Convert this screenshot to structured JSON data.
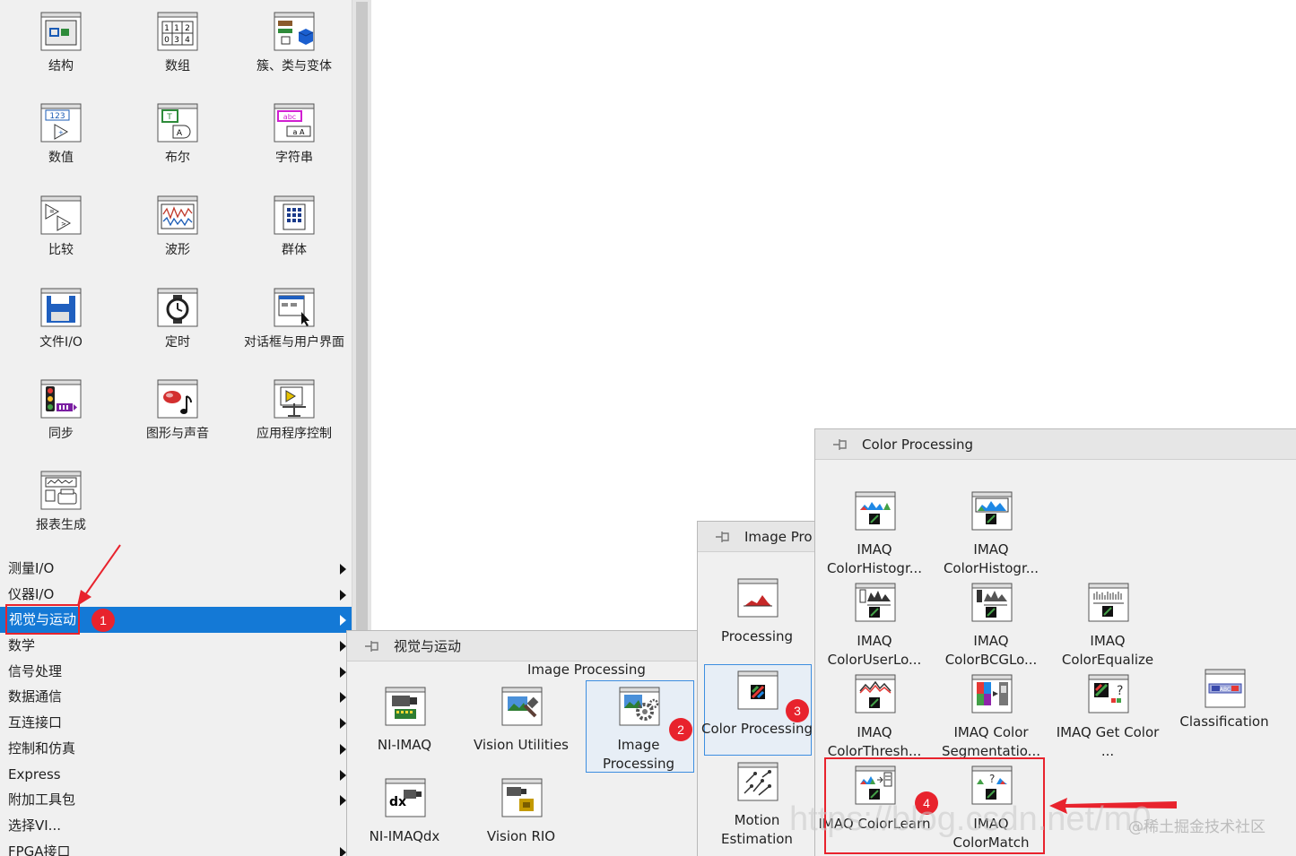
{
  "palette": {
    "items": [
      {
        "label": "结构",
        "icon": "structures-icon"
      },
      {
        "label": "数组",
        "icon": "array-icon"
      },
      {
        "label": "簇、类与变体",
        "icon": "cluster-class-variant-icon"
      },
      {
        "label": "数值",
        "icon": "numeric-icon"
      },
      {
        "label": "布尔",
        "icon": "boolean-icon"
      },
      {
        "label": "字符串",
        "icon": "string-icon"
      },
      {
        "label": "比较",
        "icon": "comparison-icon"
      },
      {
        "label": "波形",
        "icon": "waveform-icon"
      },
      {
        "label": "群体",
        "icon": "ensemble-icon"
      },
      {
        "label": "文件I/O",
        "icon": "file-io-icon"
      },
      {
        "label": "定时",
        "icon": "timing-icon"
      },
      {
        "label": "对话框与用户界面",
        "icon": "dialog-ui-icon"
      },
      {
        "label": "同步",
        "icon": "synchronization-icon"
      },
      {
        "label": "图形与声音",
        "icon": "graphics-sound-icon"
      },
      {
        "label": "应用程序控制",
        "icon": "app-control-icon"
      },
      {
        "label": "报表生成",
        "icon": "report-generation-icon"
      }
    ],
    "menu": [
      {
        "label": "测量I/O",
        "selected": false
      },
      {
        "label": "仪器I/O",
        "selected": false
      },
      {
        "label": "视觉与运动",
        "selected": true
      },
      {
        "label": "数学",
        "selected": false
      },
      {
        "label": "信号处理",
        "selected": false
      },
      {
        "label": "数据通信",
        "selected": false
      },
      {
        "label": "互连接口",
        "selected": false
      },
      {
        "label": "控制和仿真",
        "selected": false
      },
      {
        "label": "Express",
        "selected": false
      },
      {
        "label": "附加工具包",
        "selected": false
      },
      {
        "label": "选择VI...",
        "selected": false
      },
      {
        "label": "FPGA接口",
        "selected": false
      }
    ]
  },
  "vision_panel": {
    "title": "视觉与运动",
    "section": "Image Processing",
    "items": [
      {
        "label": "NI-IMAQ",
        "icon": "ni-imaq-icon"
      },
      {
        "label": "Vision Utilities",
        "icon": "vision-utilities-icon"
      },
      {
        "label": "Image Processing",
        "icon": "image-processing-icon"
      },
      {
        "label": "NI-IMAQdx",
        "icon": "ni-imaqdx-icon"
      },
      {
        "label": "Vision RIO",
        "icon": "vision-rio-icon"
      }
    ]
  },
  "image_panel": {
    "title": "Image Pro",
    "items": [
      {
        "label": "Processing",
        "icon": "processing-icon"
      },
      {
        "label": "Color Processing",
        "icon": "color-processing-icon"
      },
      {
        "label": "Motion Estimation",
        "icon": "motion-estimation-icon"
      }
    ]
  },
  "color_panel": {
    "title": "Color Processing",
    "items": [
      {
        "label": "IMAQ ColorHistogr...",
        "icon": "color-histogram-icon"
      },
      {
        "label": "IMAQ ColorHistogr...",
        "icon": "color-histograph-icon"
      },
      {
        "label": "IMAQ ColorUserLo...",
        "icon": "color-user-lookup-icon"
      },
      {
        "label": "IMAQ ColorBCGLo...",
        "icon": "color-bcg-lookup-icon"
      },
      {
        "label": "IMAQ ColorEqualize",
        "icon": "color-equalize-icon"
      },
      {
        "label": "IMAQ ColorThresh...",
        "icon": "color-threshold-icon"
      },
      {
        "label": "IMAQ Color Segmentatio...",
        "icon": "color-segmentation-icon"
      },
      {
        "label": "IMAQ Get Color ...",
        "icon": "get-color-icon"
      },
      {
        "label": "Classification",
        "icon": "classification-icon"
      },
      {
        "label": "IMAQ ColorLearn",
        "icon": "color-learn-icon"
      },
      {
        "label": "IMAQ ColorMatch",
        "icon": "color-match-icon"
      }
    ]
  },
  "annotations": {
    "badges": [
      "1",
      "2",
      "3",
      "4"
    ],
    "watermark": "@稀土掘金技术社区",
    "url_watermark": "https://blog.csdn.net/m0"
  },
  "colors": {
    "selection": "#1479d6",
    "annotation_red": "#e8232d",
    "highlight": "#3d8ee0"
  }
}
